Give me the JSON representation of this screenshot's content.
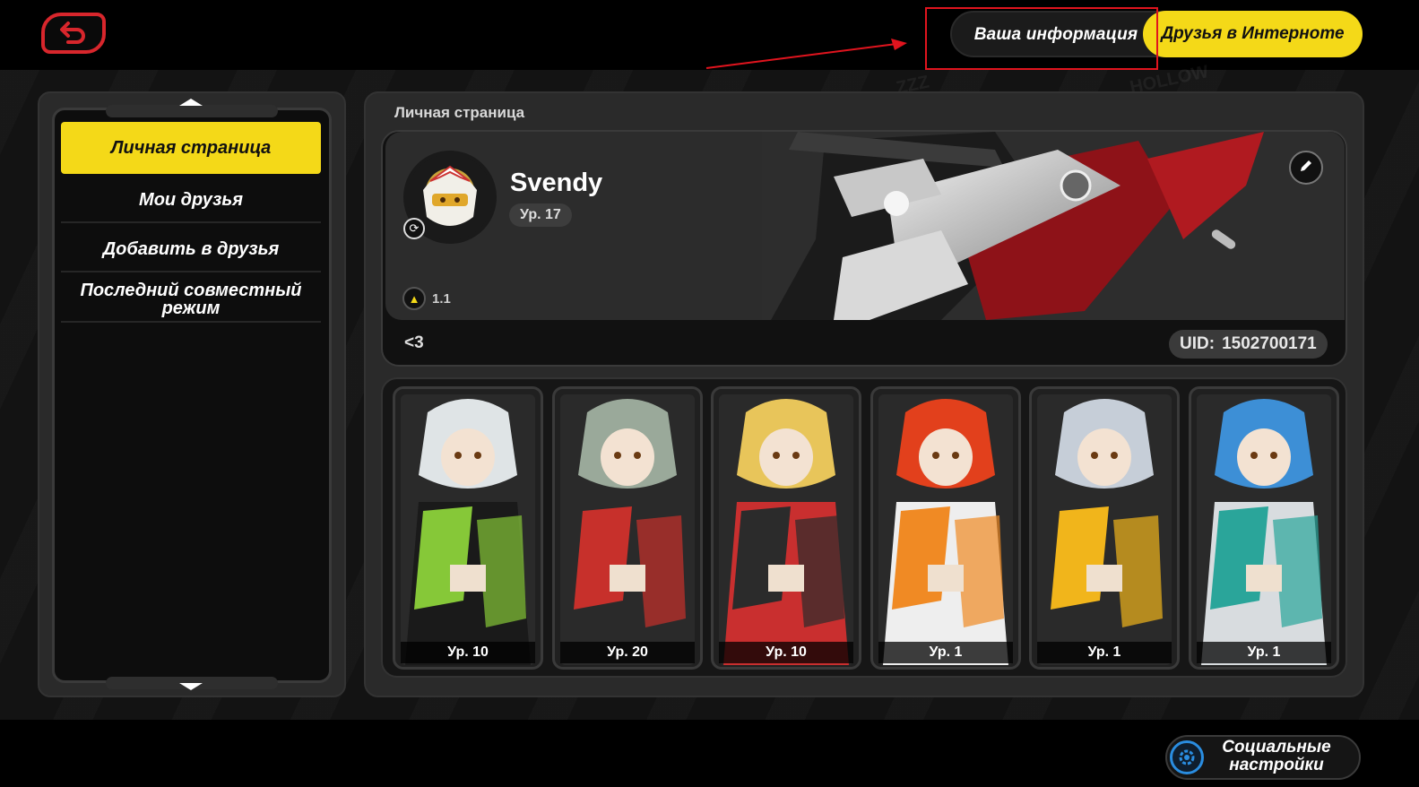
{
  "header": {
    "tabs": [
      {
        "label": "Ваша информация",
        "active": false,
        "highlighted": true
      },
      {
        "label": "Друзья в Интерноте",
        "active": true
      }
    ]
  },
  "sidebar": {
    "items": [
      {
        "label": "Личная страница",
        "active": true
      },
      {
        "label": "Мои друзья",
        "active": false
      },
      {
        "label": "Добавить в друзья",
        "active": false
      },
      {
        "label": "Последний совместный режим",
        "active": false
      }
    ]
  },
  "main": {
    "title": "Личная страница",
    "profile": {
      "username": "Svendy",
      "level": "Ур. 17",
      "stat_value": "1.1",
      "signature": "<3",
      "uid_label": "UID:",
      "uid_value": "1502700171"
    },
    "characters": [
      {
        "level": "Ур. 10",
        "palette": [
          "#dfe4e6",
          "#86c838",
          "#1a1a1a"
        ]
      },
      {
        "level": "Ур. 20",
        "palette": [
          "#9aa99a",
          "#c7302b",
          "#2a2a2a"
        ]
      },
      {
        "level": "Ур. 10",
        "palette": [
          "#e8c55a",
          "#2b2b2b",
          "#c92f2f"
        ]
      },
      {
        "level": "Ур. 1",
        "palette": [
          "#e2401c",
          "#f08a24",
          "#eeeeee"
        ]
      },
      {
        "level": "Ур. 1",
        "palette": [
          "#c6ced8",
          "#f1b51b",
          "#2a2a2a"
        ]
      },
      {
        "level": "Ур. 1",
        "palette": [
          "#3d8fd6",
          "#2aa59a",
          "#d8dcdf"
        ]
      }
    ]
  },
  "footer": {
    "social_settings_label": "Социальные настройки"
  },
  "colors": {
    "accent_yellow": "#f4d918",
    "annotation_red": "#e0141e",
    "back_red": "#d8262c"
  }
}
